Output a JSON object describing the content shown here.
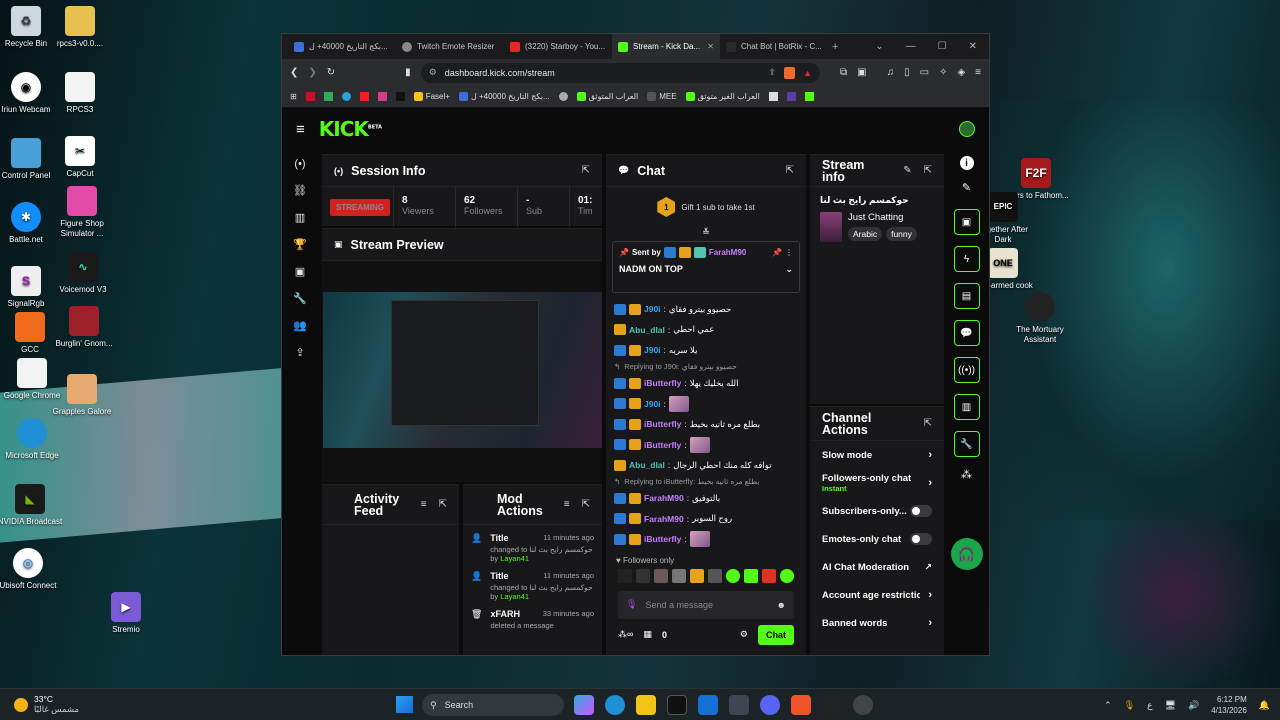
{
  "desktop": {
    "left_icons": [
      {
        "label": "Recycle Bin",
        "icon": "recycle-bin-icon"
      },
      {
        "label": "rpcs3-v0.0....",
        "icon": "folder-icon"
      },
      {
        "label": "Iriun Webcam",
        "icon": "webcam-icon"
      },
      {
        "label": "RPCS3",
        "icon": "file-icon"
      },
      {
        "label": "Control Panel",
        "icon": "control-panel-icon"
      },
      {
        "label": "CapCut",
        "icon": "capcut-icon"
      },
      {
        "label": "Battle.net",
        "icon": "battlenet-icon"
      },
      {
        "label": "Figure Shop Simulator ...",
        "icon": "figure-shop-icon"
      },
      {
        "label": "SignalRgb",
        "icon": "signalrgb-icon"
      },
      {
        "label": "Voicemod V3",
        "icon": "voicemod-icon"
      },
      {
        "label": "GCC",
        "icon": "gcc-icon"
      },
      {
        "label": "Burglin' Gnom...",
        "icon": "burglin-gnomes-icon"
      },
      {
        "label": "Google Chrome",
        "icon": "chrome-icon"
      },
      {
        "label": "Grapples Galore",
        "icon": "grapples-galore-icon"
      },
      {
        "label": "Microsoft Edge",
        "icon": "edge-icon"
      },
      {
        "label": "NVIDIA Broadcast",
        "icon": "nvidia-broadcast-icon"
      },
      {
        "label": "Ubisoft Connect",
        "icon": "ubisoft-icon"
      },
      {
        "label": "Stremio",
        "icon": "stremio-icon"
      }
    ],
    "right_icons": [
      {
        "label": "Fears to Fathom...",
        "icon": "f2f-icon"
      },
      {
        "label": "Together After Dark",
        "icon": "epic-games-icon"
      },
      {
        "label": "One-armed cook",
        "icon": "one-armed-cook-icon"
      },
      {
        "label": "The Mortuary Assistant",
        "icon": "mortuary-assistant-icon"
      }
    ]
  },
  "browser": {
    "tabs": [
      {
        "label": "بكج التاريخ 40000+ ل...",
        "active": false
      },
      {
        "label": "Twitch Emote Resizer",
        "active": false
      },
      {
        "label": "(3220) Starboy - You...",
        "active": false
      },
      {
        "label": "Stream - Kick Da...",
        "active": true
      },
      {
        "label": "Chat Bot | BotRix - C...",
        "active": false
      }
    ],
    "url": "dashboard.kick.com/stream",
    "bookmarks": [
      {
        "label": "Fasel+"
      },
      {
        "label": "بكج التاريخ 40000+ ل..."
      },
      {
        "label": "العراب المتوثق"
      },
      {
        "label": "MEE"
      },
      {
        "label": "العراب الغير متوثق"
      }
    ]
  },
  "kick": {
    "logo": "KICK",
    "logo_tag": "BETA",
    "session_info": {
      "title": "Session Info",
      "streaming_label": "STREAMING",
      "stats": [
        {
          "value": "8",
          "label": "Viewers"
        },
        {
          "value": "62",
          "label": "Followers"
        },
        {
          "value": "-",
          "label": "Sub"
        },
        {
          "value": "01:",
          "label": "Tim"
        }
      ]
    },
    "stream_preview": {
      "title": "Stream Preview"
    },
    "activity_feed": {
      "title": "Activity Feed"
    },
    "mod_actions": {
      "title": "Mod Actions",
      "entries": [
        {
          "title": "Title",
          "time": "11 minutes ago",
          "detail": "changed to حوكمسم رايح بث لنا",
          "by_label": "by",
          "by": "Layan41"
        },
        {
          "title": "Title",
          "time": "11 minutes ago",
          "detail": "changed to حوكمسم رايح بث لنا",
          "by_label": "by",
          "by": "Layan41"
        },
        {
          "title": "xFARH",
          "time": "33 minutes ago",
          "detail": "deleted a message",
          "by_label": "",
          "by": ""
        }
      ]
    },
    "chat": {
      "title": "Chat",
      "gift_text": "Gift 1 sub to take 1st",
      "gift_count": "1",
      "pinned": {
        "sent_by_label": "Sent by",
        "user": "FarahM90",
        "text": "NADM ON TOP"
      },
      "messages": [
        {
          "type": "msg",
          "user": "J90i",
          "color": "#3ba4f5",
          "text": "حصيوو بيترو فقاي"
        },
        {
          "type": "msg",
          "user": "Abu_dlal",
          "color": "#53c4b0",
          "text": "عمي احطي"
        },
        {
          "type": "msg",
          "user": "J90i",
          "color": "#3ba4f5",
          "text": "يلا سريه"
        },
        {
          "type": "reply",
          "text": "Replying to J90i: حصيوو بيترو فقاي"
        },
        {
          "type": "msg",
          "user": "iButterfly",
          "color": "#c77dff",
          "text": "الله يخليك يهلا"
        },
        {
          "type": "emote",
          "user": "J90i",
          "color": "#3ba4f5",
          "text": ""
        },
        {
          "type": "msg",
          "user": "iButterfly",
          "color": "#c77dff",
          "text": "بطلع مره ثانيه بخيط"
        },
        {
          "type": "emote",
          "user": "iButterfly",
          "color": "#c77dff",
          "text": ""
        },
        {
          "type": "msg",
          "user": "Abu_dlal",
          "color": "#53c4b0",
          "text": "توافه كله منك احطي الرجال"
        },
        {
          "type": "reply",
          "text": "Replying to iButterfly: بطلع مره ثانيه بخيط"
        },
        {
          "type": "msg",
          "user": "FarahM90",
          "color": "#c77dff",
          "text": "بالتوفيق"
        },
        {
          "type": "msg",
          "user": "FarahM90",
          "color": "#c77dff",
          "text": "روح السوبر"
        },
        {
          "type": "emote",
          "user": "iButterfly",
          "color": "#c77dff",
          "text": ""
        }
      ],
      "followers_only": "Followers only",
      "input_placeholder": "Send a message",
      "viewer_count": "0",
      "send_label": "Chat"
    },
    "stream_info": {
      "title": "Stream info",
      "stream_title": "حوكمسم رايح بث لنا",
      "category": "Just Chatting",
      "tags": [
        "Arabic",
        "funny"
      ]
    },
    "channel_actions": {
      "title": "Channel Actions",
      "items": [
        {
          "label": "Slow mode",
          "sub": "",
          "control": "chevron"
        },
        {
          "label": "Followers-only chat",
          "sub": "Instant",
          "control": "chevron"
        },
        {
          "label": "Subscribers-only...",
          "sub": "",
          "control": "toggle"
        },
        {
          "label": "Emotes-only chat",
          "sub": "",
          "control": "toggle"
        },
        {
          "label": "AI Chat Moderation",
          "sub": "",
          "control": "external"
        },
        {
          "label": "Account age restrictio",
          "sub": "",
          "control": "chevron"
        },
        {
          "label": "Banned words",
          "sub": "",
          "control": "chevron"
        }
      ]
    }
  },
  "taskbar": {
    "weather_temp": "33°C",
    "weather_desc": "مشمس غالبًا",
    "search_label": "Search",
    "time": "6:12 PM",
    "date": "4/13/2026",
    "lang": "ع"
  },
  "colors": {
    "kick_green": "#53fc18",
    "streaming_red": "#d32121"
  }
}
